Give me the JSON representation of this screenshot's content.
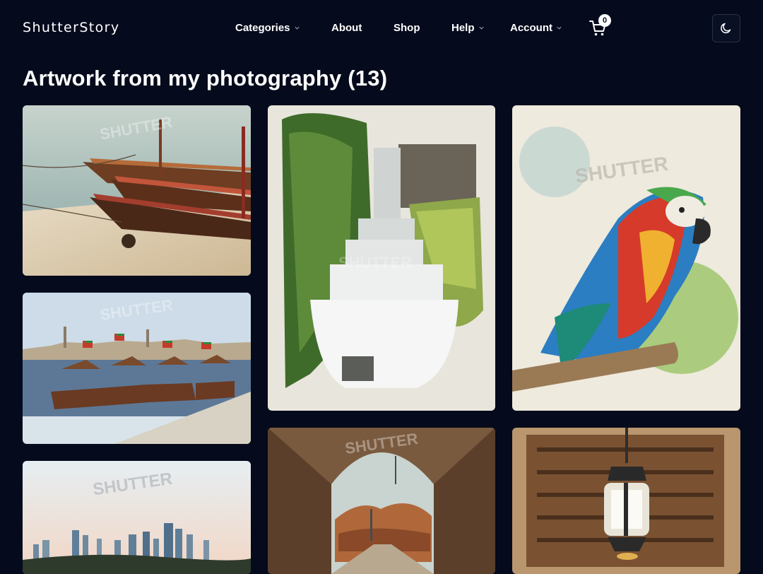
{
  "header": {
    "brand": "ShutterStory",
    "nav": {
      "categories": "Categories",
      "about": "About",
      "shop": "Shop",
      "help": "Help",
      "account": "Account"
    },
    "cart_count": "0",
    "icons": {
      "cart": "cart-icon",
      "theme": "moon-icon",
      "dropdown": "chevron-down-icon"
    }
  },
  "main": {
    "title": "Artwork from my photography (13)",
    "watermark": "SHUTTER",
    "artworks": [
      {
        "subject": "boats"
      },
      {
        "subject": "waterfall"
      },
      {
        "subject": "parrot"
      },
      {
        "subject": "abra"
      },
      {
        "subject": "skyline"
      },
      {
        "subject": "tunnel"
      },
      {
        "subject": "lantern"
      }
    ]
  },
  "colors": {
    "background": "#050a1c",
    "text": "#ffffff",
    "border": "#2a3246"
  }
}
